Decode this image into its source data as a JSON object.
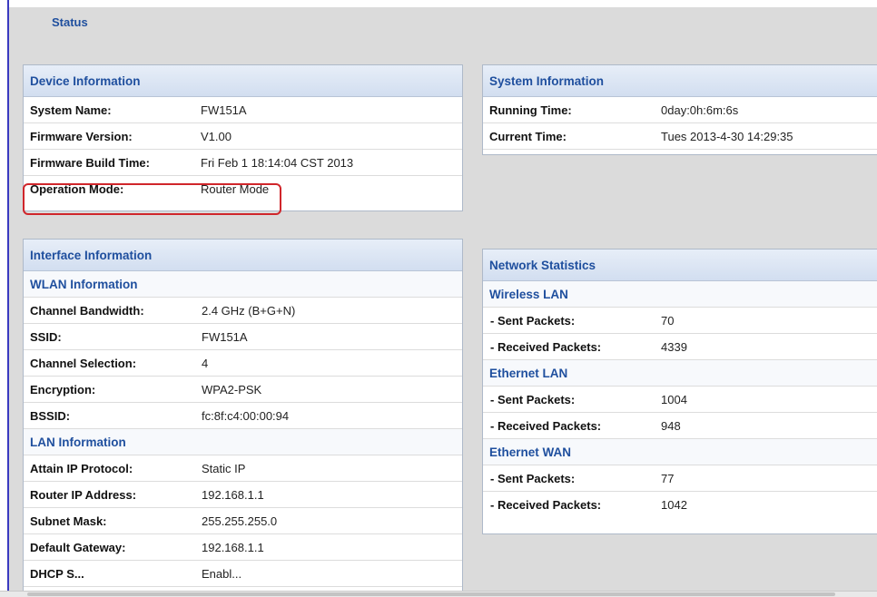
{
  "page": {
    "title": "Status"
  },
  "device_info": {
    "heading": "Device Information",
    "rows": [
      {
        "label": "System Name:",
        "value": "FW151A"
      },
      {
        "label": "Firmware Version:",
        "value": "V1.00"
      },
      {
        "label": "Firmware Build Time:",
        "value": "Fri Feb 1 18:14:04 CST 2013"
      },
      {
        "label": "Operation Mode:",
        "value": "Router Mode"
      }
    ]
  },
  "system_info": {
    "heading": "System Information",
    "rows": [
      {
        "label": "Running Time:",
        "value": "0day:0h:6m:6s"
      },
      {
        "label": "Current Time:",
        "value": "Tues 2013-4-30 14:29:35"
      }
    ]
  },
  "interface_info": {
    "heading": "Interface Information",
    "wlan": {
      "heading": "WLAN Information",
      "rows": [
        {
          "label": "Channel Bandwidth:",
          "value": "2.4 GHz (B+G+N)"
        },
        {
          "label": "SSID:",
          "value": "FW151A"
        },
        {
          "label": "Channel Selection:",
          "value": "4"
        },
        {
          "label": "Encryption:",
          "value": "WPA2-PSK"
        },
        {
          "label": "BSSID:",
          "value": "fc:8f:c4:00:00:94"
        }
      ]
    },
    "lan": {
      "heading": "LAN Information",
      "rows": [
        {
          "label": "Attain IP Protocol:",
          "value": "Static IP"
        },
        {
          "label": "Router IP Address:",
          "value": "192.168.1.1"
        },
        {
          "label": "Subnet Mask:",
          "value": "255.255.255.0"
        },
        {
          "label": "Default Gateway:",
          "value": "192.168.1.1"
        },
        {
          "label": "DHCP S...",
          "value": "Enabl..."
        }
      ]
    }
  },
  "network_stats": {
    "heading": "Network Statistics",
    "groups": [
      {
        "heading": "Wireless LAN",
        "rows": [
          {
            "label": "- Sent Packets:",
            "value": "70"
          },
          {
            "label": "- Received Packets:",
            "value": "4339"
          }
        ]
      },
      {
        "heading": "Ethernet LAN",
        "rows": [
          {
            "label": "- Sent Packets:",
            "value": "1004"
          },
          {
            "label": "- Received Packets:",
            "value": "948"
          }
        ]
      },
      {
        "heading": "Ethernet WAN",
        "rows": [
          {
            "label": "- Sent Packets:",
            "value": "77"
          },
          {
            "label": "- Received Packets:",
            "value": "1042"
          }
        ]
      }
    ]
  },
  "colors": {
    "accent": "#1f4f9e",
    "highlight": "#d0262b",
    "background": "#dbdbdb"
  }
}
